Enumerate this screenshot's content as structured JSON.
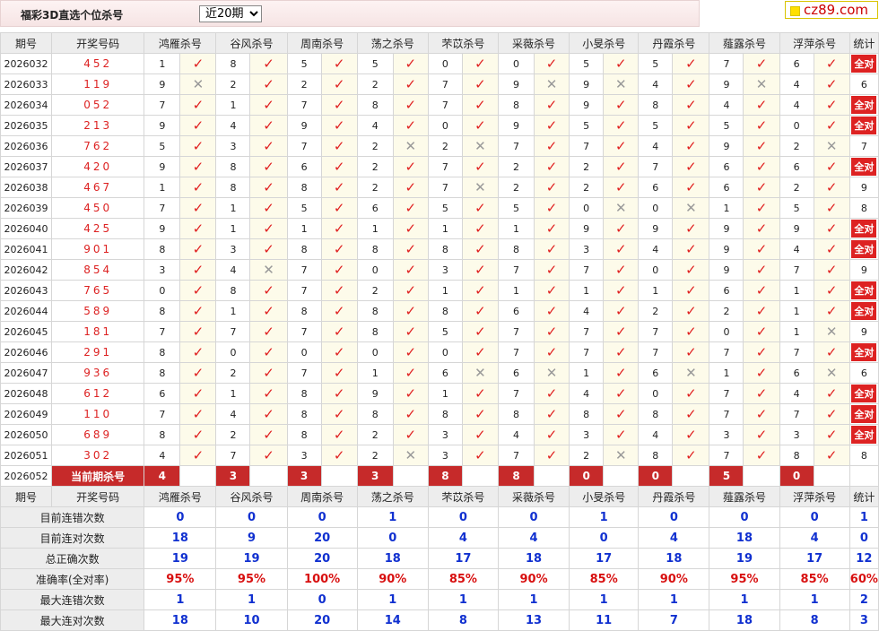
{
  "header": {
    "title": "福彩3D直选个位杀号",
    "period_option": "近20期",
    "site_logo": "cz89.com"
  },
  "columns": [
    "期号",
    "开奖号码",
    "鸿雁杀号",
    "谷风杀号",
    "周南杀号",
    "荡之杀号",
    "芣苡杀号",
    "采薇杀号",
    "小旻杀号",
    "丹霞杀号",
    "薤露杀号",
    "浮萍杀号",
    "统计"
  ],
  "rows": [
    {
      "issue": "2026032",
      "draw": "452",
      "kills": [
        [
          1,
          1
        ],
        [
          8,
          1
        ],
        [
          5,
          1
        ],
        [
          5,
          1
        ],
        [
          0,
          1
        ],
        [
          0,
          1
        ],
        [
          5,
          1
        ],
        [
          5,
          1
        ],
        [
          7,
          1
        ],
        [
          6,
          1
        ]
      ],
      "stat": "全对"
    },
    {
      "issue": "2026033",
      "draw": "119",
      "kills": [
        [
          9,
          0
        ],
        [
          2,
          1
        ],
        [
          2,
          1
        ],
        [
          2,
          1
        ],
        [
          7,
          1
        ],
        [
          9,
          0
        ],
        [
          9,
          0
        ],
        [
          4,
          1
        ],
        [
          9,
          0
        ],
        [
          4,
          1
        ]
      ],
      "stat": "6"
    },
    {
      "issue": "2026034",
      "draw": "052",
      "kills": [
        [
          7,
          1
        ],
        [
          1,
          1
        ],
        [
          7,
          1
        ],
        [
          8,
          1
        ],
        [
          7,
          1
        ],
        [
          8,
          1
        ],
        [
          9,
          1
        ],
        [
          8,
          1
        ],
        [
          4,
          1
        ],
        [
          4,
          1
        ]
      ],
      "stat": "全对"
    },
    {
      "issue": "2026035",
      "draw": "213",
      "kills": [
        [
          9,
          1
        ],
        [
          4,
          1
        ],
        [
          9,
          1
        ],
        [
          4,
          1
        ],
        [
          0,
          1
        ],
        [
          9,
          1
        ],
        [
          5,
          1
        ],
        [
          5,
          1
        ],
        [
          5,
          1
        ],
        [
          0,
          1
        ]
      ],
      "stat": "全对"
    },
    {
      "issue": "2026036",
      "draw": "762",
      "kills": [
        [
          5,
          1
        ],
        [
          3,
          1
        ],
        [
          7,
          1
        ],
        [
          2,
          0
        ],
        [
          2,
          0
        ],
        [
          7,
          1
        ],
        [
          7,
          1
        ],
        [
          4,
          1
        ],
        [
          9,
          1
        ],
        [
          2,
          0
        ]
      ],
      "stat": "7"
    },
    {
      "issue": "2026037",
      "draw": "420",
      "kills": [
        [
          9,
          1
        ],
        [
          8,
          1
        ],
        [
          6,
          1
        ],
        [
          2,
          1
        ],
        [
          7,
          1
        ],
        [
          2,
          1
        ],
        [
          2,
          1
        ],
        [
          7,
          1
        ],
        [
          6,
          1
        ],
        [
          6,
          1
        ]
      ],
      "stat": "全对"
    },
    {
      "issue": "2026038",
      "draw": "467",
      "kills": [
        [
          1,
          1
        ],
        [
          8,
          1
        ],
        [
          8,
          1
        ],
        [
          2,
          1
        ],
        [
          7,
          0
        ],
        [
          2,
          1
        ],
        [
          2,
          1
        ],
        [
          6,
          1
        ],
        [
          6,
          1
        ],
        [
          2,
          1
        ]
      ],
      "stat": "9"
    },
    {
      "issue": "2026039",
      "draw": "450",
      "kills": [
        [
          7,
          1
        ],
        [
          1,
          1
        ],
        [
          5,
          1
        ],
        [
          6,
          1
        ],
        [
          5,
          1
        ],
        [
          5,
          1
        ],
        [
          0,
          0
        ],
        [
          0,
          0
        ],
        [
          1,
          1
        ],
        [
          5,
          1
        ]
      ],
      "stat": "8"
    },
    {
      "issue": "2026040",
      "draw": "425",
      "kills": [
        [
          9,
          1
        ],
        [
          1,
          1
        ],
        [
          1,
          1
        ],
        [
          1,
          1
        ],
        [
          1,
          1
        ],
        [
          1,
          1
        ],
        [
          9,
          1
        ],
        [
          9,
          1
        ],
        [
          9,
          1
        ],
        [
          9,
          1
        ]
      ],
      "stat": "全对"
    },
    {
      "issue": "2026041",
      "draw": "901",
      "kills": [
        [
          8,
          1
        ],
        [
          3,
          1
        ],
        [
          8,
          1
        ],
        [
          8,
          1
        ],
        [
          8,
          1
        ],
        [
          8,
          1
        ],
        [
          3,
          1
        ],
        [
          4,
          1
        ],
        [
          9,
          1
        ],
        [
          4,
          1
        ]
      ],
      "stat": "全对"
    },
    {
      "issue": "2026042",
      "draw": "854",
      "kills": [
        [
          3,
          1
        ],
        [
          4,
          0
        ],
        [
          7,
          1
        ],
        [
          0,
          1
        ],
        [
          3,
          1
        ],
        [
          7,
          1
        ],
        [
          7,
          1
        ],
        [
          0,
          1
        ],
        [
          9,
          1
        ],
        [
          7,
          1
        ]
      ],
      "stat": "9"
    },
    {
      "issue": "2026043",
      "draw": "765",
      "kills": [
        [
          0,
          1
        ],
        [
          8,
          1
        ],
        [
          7,
          1
        ],
        [
          2,
          1
        ],
        [
          1,
          1
        ],
        [
          1,
          1
        ],
        [
          1,
          1
        ],
        [
          1,
          1
        ],
        [
          6,
          1
        ],
        [
          1,
          1
        ]
      ],
      "stat": "全对"
    },
    {
      "issue": "2026044",
      "draw": "589",
      "kills": [
        [
          8,
          1
        ],
        [
          1,
          1
        ],
        [
          8,
          1
        ],
        [
          8,
          1
        ],
        [
          8,
          1
        ],
        [
          6,
          1
        ],
        [
          4,
          1
        ],
        [
          2,
          1
        ],
        [
          2,
          1
        ],
        [
          1,
          1
        ]
      ],
      "stat": "全对"
    },
    {
      "issue": "2026045",
      "draw": "181",
      "kills": [
        [
          7,
          1
        ],
        [
          7,
          1
        ],
        [
          7,
          1
        ],
        [
          8,
          1
        ],
        [
          5,
          1
        ],
        [
          7,
          1
        ],
        [
          7,
          1
        ],
        [
          7,
          1
        ],
        [
          0,
          1
        ],
        [
          1,
          0
        ]
      ],
      "stat": "9"
    },
    {
      "issue": "2026046",
      "draw": "291",
      "kills": [
        [
          8,
          1
        ],
        [
          0,
          1
        ],
        [
          0,
          1
        ],
        [
          0,
          1
        ],
        [
          0,
          1
        ],
        [
          7,
          1
        ],
        [
          7,
          1
        ],
        [
          7,
          1
        ],
        [
          7,
          1
        ],
        [
          7,
          1
        ]
      ],
      "stat": "全对"
    },
    {
      "issue": "2026047",
      "draw": "936",
      "kills": [
        [
          8,
          1
        ],
        [
          2,
          1
        ],
        [
          7,
          1
        ],
        [
          1,
          1
        ],
        [
          6,
          0
        ],
        [
          6,
          0
        ],
        [
          1,
          1
        ],
        [
          6,
          0
        ],
        [
          1,
          1
        ],
        [
          6,
          0
        ]
      ],
      "stat": "6"
    },
    {
      "issue": "2026048",
      "draw": "612",
      "kills": [
        [
          6,
          1
        ],
        [
          1,
          1
        ],
        [
          8,
          1
        ],
        [
          9,
          1
        ],
        [
          1,
          1
        ],
        [
          7,
          1
        ],
        [
          4,
          1
        ],
        [
          0,
          1
        ],
        [
          7,
          1
        ],
        [
          4,
          1
        ]
      ],
      "stat": "全对"
    },
    {
      "issue": "2026049",
      "draw": "110",
      "kills": [
        [
          7,
          1
        ],
        [
          4,
          1
        ],
        [
          8,
          1
        ],
        [
          8,
          1
        ],
        [
          8,
          1
        ],
        [
          8,
          1
        ],
        [
          8,
          1
        ],
        [
          8,
          1
        ],
        [
          7,
          1
        ],
        [
          7,
          1
        ]
      ],
      "stat": "全对"
    },
    {
      "issue": "2026050",
      "draw": "689",
      "kills": [
        [
          8,
          1
        ],
        [
          2,
          1
        ],
        [
          8,
          1
        ],
        [
          2,
          1
        ],
        [
          3,
          1
        ],
        [
          4,
          1
        ],
        [
          3,
          1
        ],
        [
          4,
          1
        ],
        [
          3,
          1
        ],
        [
          3,
          1
        ]
      ],
      "stat": "全对"
    },
    {
      "issue": "2026051",
      "draw": "302",
      "kills": [
        [
          4,
          1
        ],
        [
          7,
          1
        ],
        [
          3,
          1
        ],
        [
          2,
          0
        ],
        [
          3,
          1
        ],
        [
          7,
          1
        ],
        [
          2,
          0
        ],
        [
          8,
          1
        ],
        [
          7,
          1
        ],
        [
          8,
          1
        ]
      ],
      "stat": "8"
    }
  ],
  "current": {
    "issue": "2026052",
    "label": "当前期杀号",
    "values": [
      "4",
      "3",
      "3",
      "3",
      "8",
      "8",
      "0",
      "0",
      "5",
      "0"
    ]
  },
  "summary_labels": [
    "目前连错次数",
    "目前连对次数",
    "总正确次数",
    "准确率(全对率)",
    "最大连错次数",
    "最大连对次数"
  ],
  "summary": [
    [
      "0",
      "0",
      "0",
      "1",
      "0",
      "0",
      "1",
      "0",
      "0",
      "0",
      "1"
    ],
    [
      "18",
      "9",
      "20",
      "0",
      "4",
      "4",
      "0",
      "4",
      "18",
      "4",
      "0"
    ],
    [
      "19",
      "19",
      "20",
      "18",
      "17",
      "18",
      "17",
      "18",
      "19",
      "17",
      "12"
    ],
    [
      "95%",
      "95%",
      "100%",
      "90%",
      "85%",
      "90%",
      "85%",
      "90%",
      "95%",
      "85%",
      "60%"
    ],
    [
      "1",
      "1",
      "0",
      "1",
      "1",
      "1",
      "1",
      "1",
      "1",
      "1",
      "2"
    ],
    [
      "18",
      "10",
      "20",
      "14",
      "8",
      "13",
      "11",
      "7",
      "18",
      "8",
      "3"
    ]
  ],
  "marks": {
    "ok": "✓",
    "bad": "✕"
  },
  "colors": {
    "accent": "#d22222",
    "current_bg": "#c62a2a",
    "stat_blue": "#1030d0",
    "mark_bg": "#fdfbea"
  }
}
